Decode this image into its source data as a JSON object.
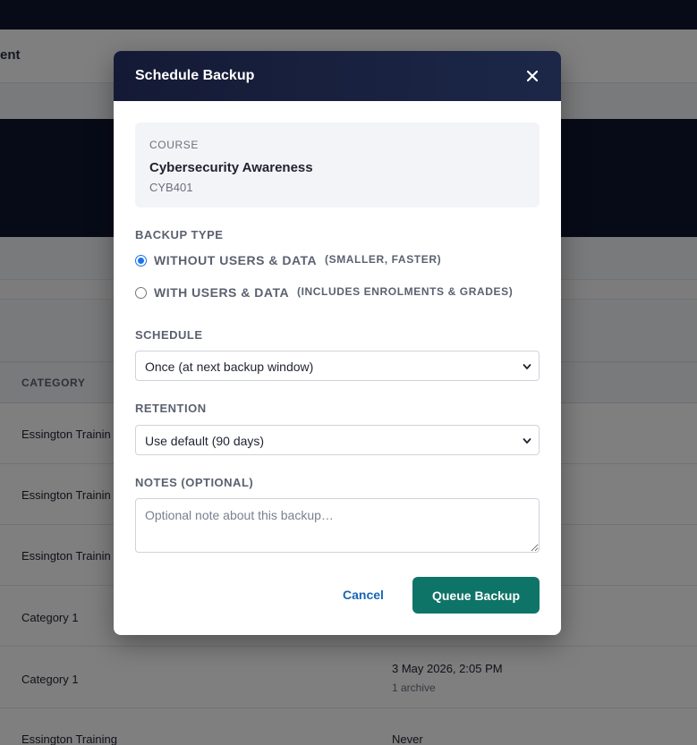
{
  "background": {
    "subnav_text": "ent",
    "table_header_category": "CATEGORY",
    "rows": [
      {
        "category": "Essington Trainin",
        "date": "",
        "sub": ""
      },
      {
        "category": "Essington Trainin",
        "date": "",
        "sub": ""
      },
      {
        "category": "Essington Trainin",
        "date": "",
        "sub": ""
      },
      {
        "category": "Category 1",
        "date": "",
        "sub": ""
      },
      {
        "category": "Category 1",
        "date": "3 May 2026, 2:05 PM",
        "sub": "1 archive"
      },
      {
        "category": "Essington Training",
        "date": "Never",
        "sub": ""
      }
    ]
  },
  "modal": {
    "title": "Schedule Backup",
    "close_icon": "close-icon",
    "course": {
      "label": "COURSE",
      "name": "Cybersecurity Awareness",
      "code": "CYB401"
    },
    "backup_type": {
      "label": "BACKUP TYPE",
      "options": [
        {
          "label": "WITHOUT USERS & DATA",
          "hint": "(SMALLER, FASTER)",
          "checked": true
        },
        {
          "label": "WITH USERS & DATA",
          "hint": "(INCLUDES ENROLMENTS & GRADES)",
          "checked": false
        }
      ]
    },
    "schedule": {
      "label": "SCHEDULE",
      "value": "Once (at next backup window)"
    },
    "retention": {
      "label": "RETENTION",
      "value": "Use default (90 days)"
    },
    "notes": {
      "label": "NOTES (OPTIONAL)",
      "placeholder": "Optional note about this backup…",
      "value": ""
    },
    "cancel_label": "Cancel",
    "submit_label": "Queue Backup"
  },
  "colors": {
    "header_bg": "#141a35",
    "primary_button": "#0f7468",
    "link": "#1766b8",
    "radio_accent": "#1a73e8"
  }
}
